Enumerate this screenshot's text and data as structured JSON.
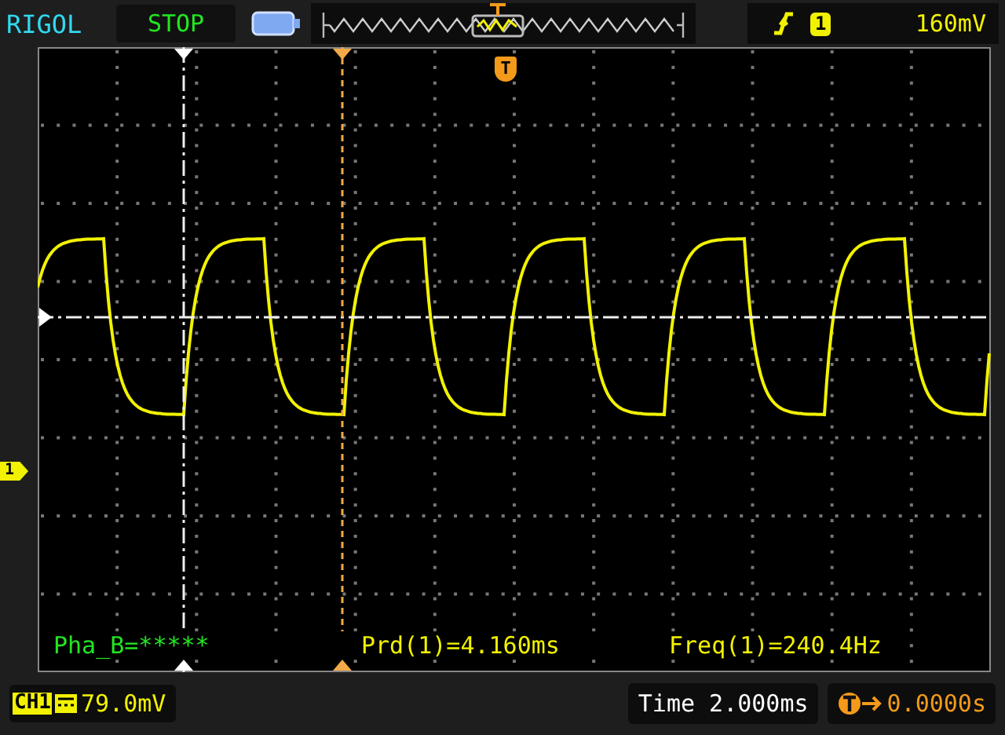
{
  "brand": "RIGOL",
  "run_state": "STOP",
  "trigger": {
    "channel": "1",
    "level": "160mV"
  },
  "markers": {
    "channel": "1",
    "trigger": "T"
  },
  "measurements": [
    {
      "text": "Pha_B=*****",
      "color": "#22e622"
    },
    {
      "text": "Prd(1)=4.160ms",
      "color": "#f2f200"
    },
    {
      "text": "Freq(1)=240.4Hz",
      "color": "#f2f200"
    }
  ],
  "channel": {
    "label": "CH1",
    "scale": "79.0mV"
  },
  "timebase": "Time 2.000ms",
  "trigger_offset": "0.0000s"
}
